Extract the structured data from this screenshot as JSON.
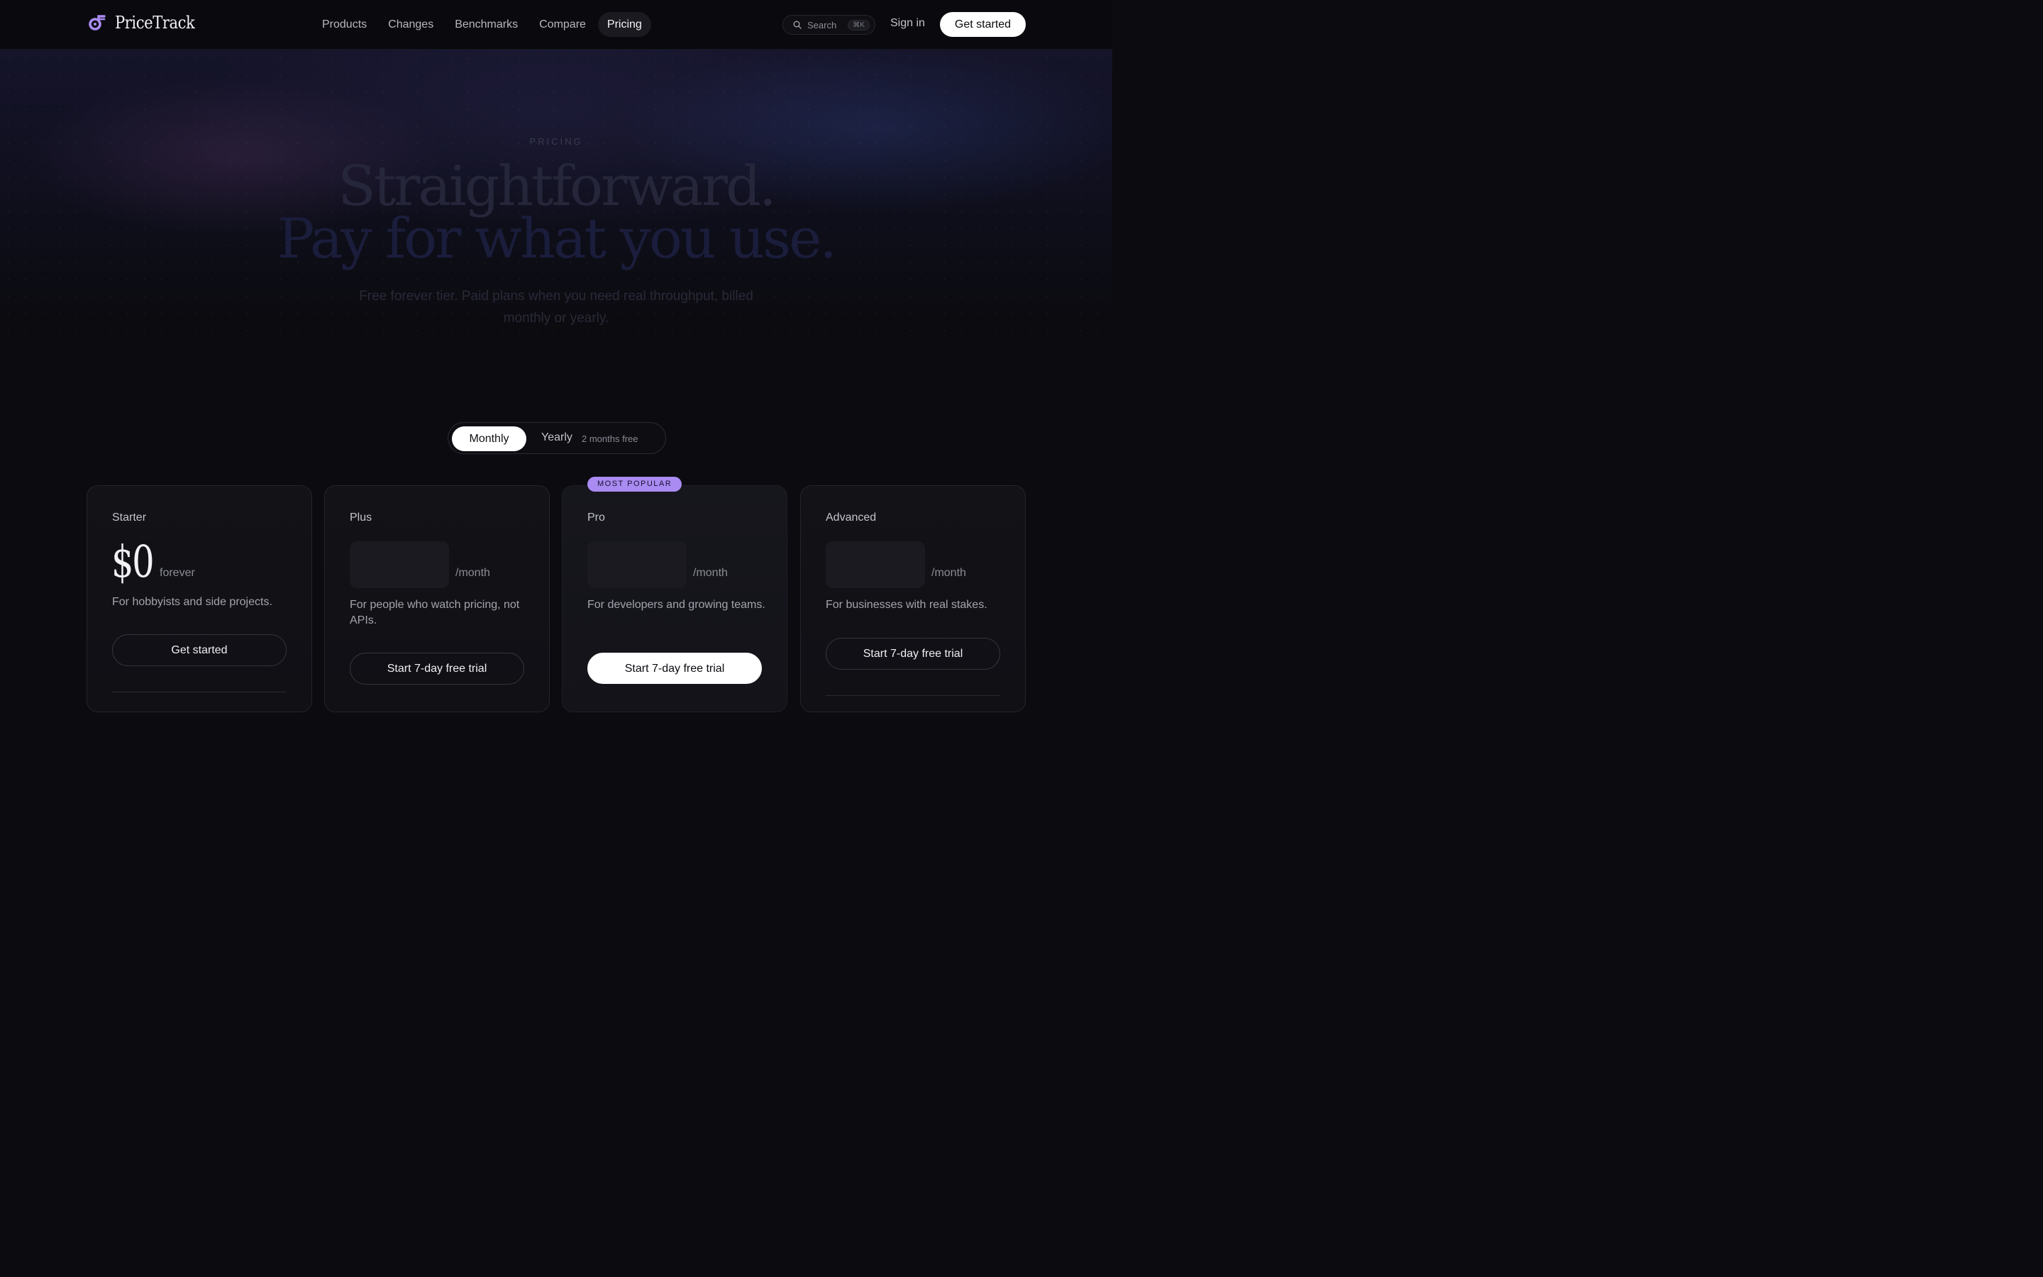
{
  "brand": {
    "name": "PriceTrack",
    "accent": "#a98bf2"
  },
  "nav": {
    "links": [
      "Products",
      "Changes",
      "Benchmarks",
      "Compare",
      "Pricing"
    ],
    "active": "Pricing",
    "search_label": "Search",
    "search_shortcut": "⌘K",
    "sign_in": "Sign in",
    "cta": "Get started"
  },
  "hero": {
    "eyebrow": "PRICING",
    "headline_line1": "Straightforward.",
    "headline_line2": "Pay for what you use.",
    "subtitle": "Free forever tier. Paid plans when you need real throughput, billed monthly or yearly."
  },
  "billing_toggle": {
    "monthly": "Monthly",
    "yearly": "Yearly",
    "yearly_note": "2 months free",
    "selected": "Monthly"
  },
  "plans": [
    {
      "name": "Starter",
      "price": "$0",
      "unit": "forever",
      "description": "For hobbyists and side projects.",
      "cta": "Get started"
    },
    {
      "name": "Plus",
      "price": "",
      "unit": "/month",
      "description": "For people who watch pricing, not APIs.",
      "cta": "Start 7-day free trial"
    },
    {
      "name": "Pro",
      "badge": "MOST POPULAR",
      "price": "",
      "unit": "/month",
      "description": "For developers and growing teams.",
      "cta": "Start 7-day free trial"
    },
    {
      "name": "Advanced",
      "price": "",
      "unit": "/month",
      "description": "For businesses with real stakes.",
      "cta": "Start 7-day free trial"
    }
  ]
}
